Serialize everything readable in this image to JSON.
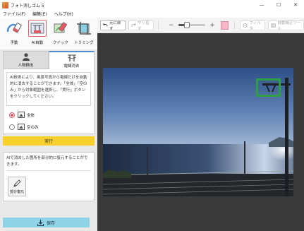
{
  "window": {
    "title": "フォト消しゴム 5",
    "min": "—",
    "max": "☐",
    "close": "✕"
  },
  "menu": [
    "ファイル(F)",
    "編集(E)",
    "ヘルプ(H)"
  ],
  "tools": [
    {
      "label": "手動",
      "icon": "manual-brush-icon"
    },
    {
      "label": "AI自動",
      "icon": "ai-auto-icon"
    },
    {
      "label": "クイック",
      "icon": "quick-eraser-icon"
    },
    {
      "label": "トリミング",
      "icon": "trimming-icon"
    }
  ],
  "tabs": [
    {
      "label": "人物検出",
      "icon": "person-icon"
    },
    {
      "label": "電線消去",
      "icon": "power-line-icon"
    }
  ],
  "ai_panel": {
    "description": "AI技術により、風景写真から電線だけを自動的に消去することができます。「全体」「空のみ」から対象範囲を選択し、「実行」ボタンをクリックしてください。",
    "options": [
      {
        "label": "全体",
        "selected": true
      },
      {
        "label": "空のみ",
        "selected": false
      }
    ],
    "run_label": "実行"
  },
  "partial_panel": {
    "description": "AIで消去した箇所を部分的に復元することができます。",
    "button_label": "部分復元"
  },
  "save_label": "保存",
  "topbar": {
    "undo": "元に戻す",
    "redo": "やり直す",
    "zoom_percent": 32,
    "filter": "フィルタ",
    "correction": "自動補正ツール"
  },
  "colors": {
    "accent": "#e05a6a",
    "run": "#f7d02b",
    "save": "#8fd3e6",
    "detect": "#2ea043"
  }
}
